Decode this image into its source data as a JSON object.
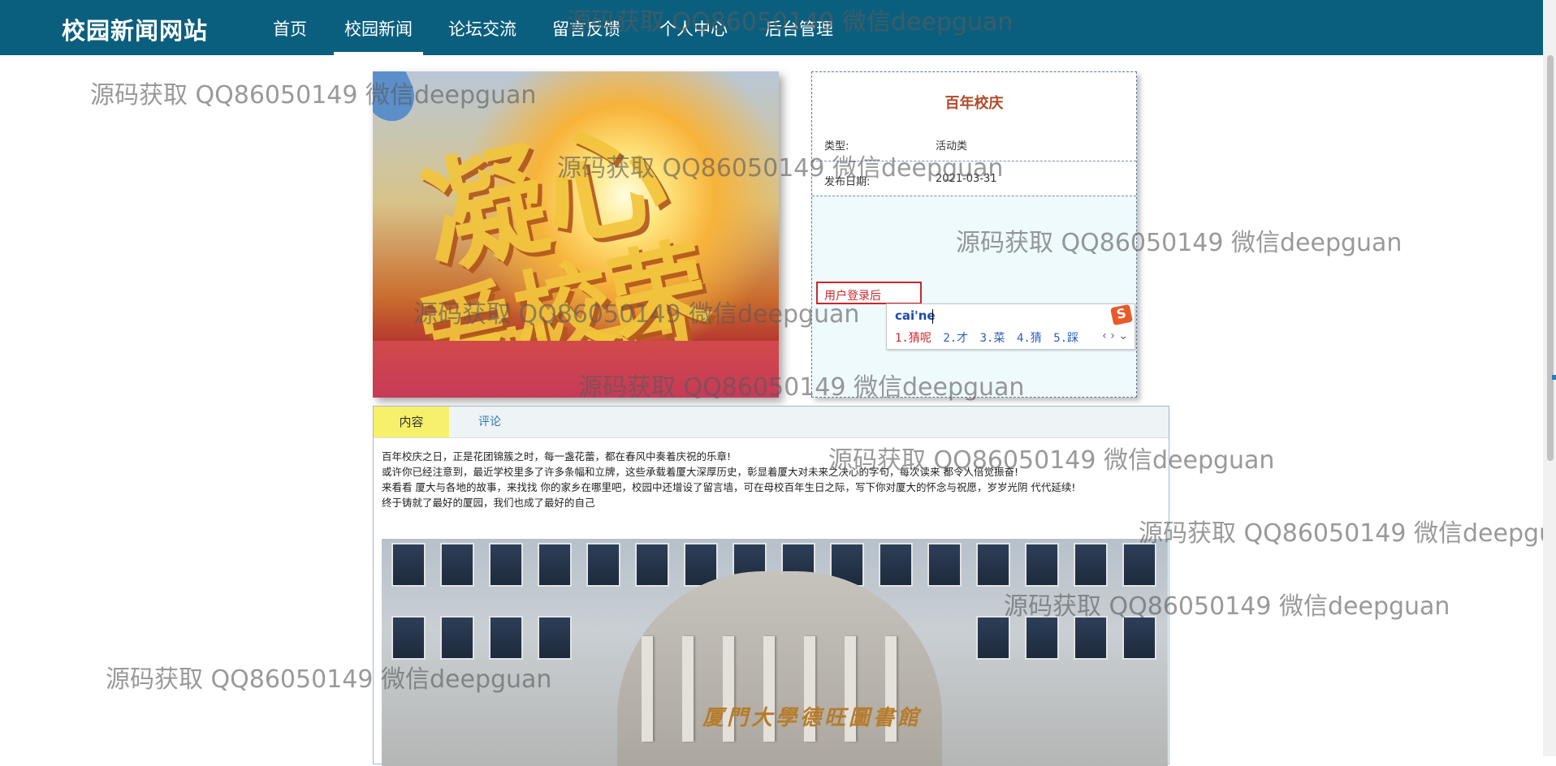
{
  "navbar": {
    "brand": "校园新闻网站",
    "items": [
      "首页",
      "校园新闻",
      "论坛交流",
      "留言反馈",
      "个人中心",
      "后台管理"
    ],
    "active": "校园新闻"
  },
  "hero_image": {
    "slogan_line1": "凝心聚力",
    "slogan_line2": "爱校荣校"
  },
  "news": {
    "title": "百年校庆",
    "type_label": "类型:",
    "type_value": "活动类",
    "date_label": "发布日期:",
    "date_value": "2021-03-31",
    "login_note": "用户登录后"
  },
  "ime": {
    "input": "cai'ne",
    "logo": "S",
    "candidates": [
      "1.猜呢",
      "2.才",
      "3.菜",
      "4.猜",
      "5.踩"
    ],
    "nav": "‹ › ⌄"
  },
  "tabs": {
    "content": "内容",
    "comments": "评论"
  },
  "article": {
    "lines": [
      "百年校庆之日，正是花团锦簇之时，每一盏花蕾，都在春风中奏着庆祝的乐章!",
      "或许你已经注意到，最近学校里多了许多条幅和立牌，这些承载着厦大深厚历史，彰显着厦大对未来之决心的字句，每次读来 都令人倍觉振奋!",
      "来看看 厦大与各地的故事，来找找 你的家乡在哪里吧，校园中还增设了留言墙，可在母校百年生日之际，写下你对厦大的怀念与祝愿，岁岁光阴 代代延续!",
      "终于铸就了最好的厦园，我们也成了最好的自己"
    ],
    "building_sign": "厦門大學德旺圖書館"
  },
  "watermark": "源码获取 QQ86050149 微信deepguan"
}
